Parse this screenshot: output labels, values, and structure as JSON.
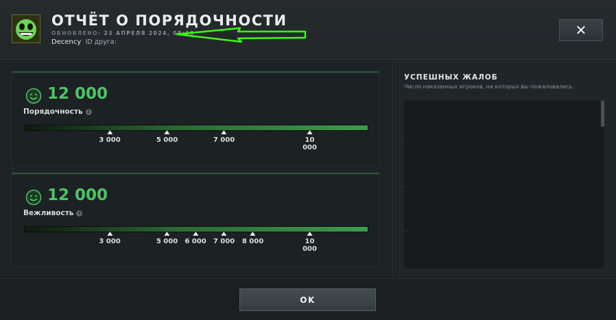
{
  "header": {
    "title": "ОТЧЁТ О ПОРЯДОЧНОСТИ",
    "updated_label": "ОБНОВЛЕНО:",
    "updated_value": "23 АПРЕЛЯ 2024, 08:09",
    "player_name": "Decency",
    "friend_id_label": "ID друга:",
    "close_label": "✕"
  },
  "cards": [
    {
      "score": "12 000",
      "label": "Порядочность",
      "info_icon": "i",
      "bar_fill": 1.0,
      "ticks": [
        {
          "label": "3 000",
          "pos": 0.25
        },
        {
          "label": "5 000",
          "pos": 0.417
        },
        {
          "label": "7 000",
          "pos": 0.583
        },
        {
          "label": "10\n000",
          "pos": 0.833
        }
      ]
    },
    {
      "score": "12 000",
      "label": "Вежливость",
      "info_icon": "i",
      "bar_fill": 1.0,
      "ticks": [
        {
          "label": "3 000",
          "pos": 0.25
        },
        {
          "label": "5 000",
          "pos": 0.417
        },
        {
          "label": "6 000",
          "pos": 0.5
        },
        {
          "label": "7 000",
          "pos": 0.583
        },
        {
          "label": "8 000",
          "pos": 0.667
        },
        {
          "label": "10\n000",
          "pos": 0.833
        }
      ]
    }
  ],
  "reports": {
    "title": "УСПЕШНЫХ ЖАЛОБ",
    "subtitle": "Число наказанных игроков, на которых вы пожаловались."
  },
  "footer": {
    "ok_label": "OK"
  },
  "colors": {
    "accent_green": "#4cc465",
    "arrow_green": "#39ff14"
  },
  "icons": [
    "avatar-icon",
    "smiley-icon",
    "info-icon",
    "close-icon",
    "arrow-annotation-icon"
  ]
}
